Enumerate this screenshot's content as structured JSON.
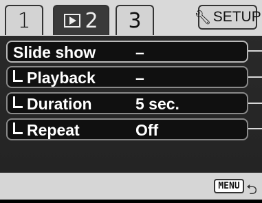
{
  "tabs": [
    {
      "label": "1"
    },
    {
      "label": "2",
      "icon": "playback-icon"
    },
    {
      "label": "3"
    }
  ],
  "setup": {
    "label": "SETUP",
    "icon": "wrench-icon"
  },
  "menu": {
    "rows": [
      {
        "label": "Slide show",
        "value": "–",
        "sub": false
      },
      {
        "label": "Playback",
        "value": "–",
        "sub": true
      },
      {
        "label": "Duration",
        "value": "5 sec.",
        "sub": true
      },
      {
        "label": "Repeat",
        "value": "Off",
        "sub": true
      }
    ]
  },
  "footer": {
    "menu_label": "MENU",
    "return_icon": "return-icon"
  }
}
